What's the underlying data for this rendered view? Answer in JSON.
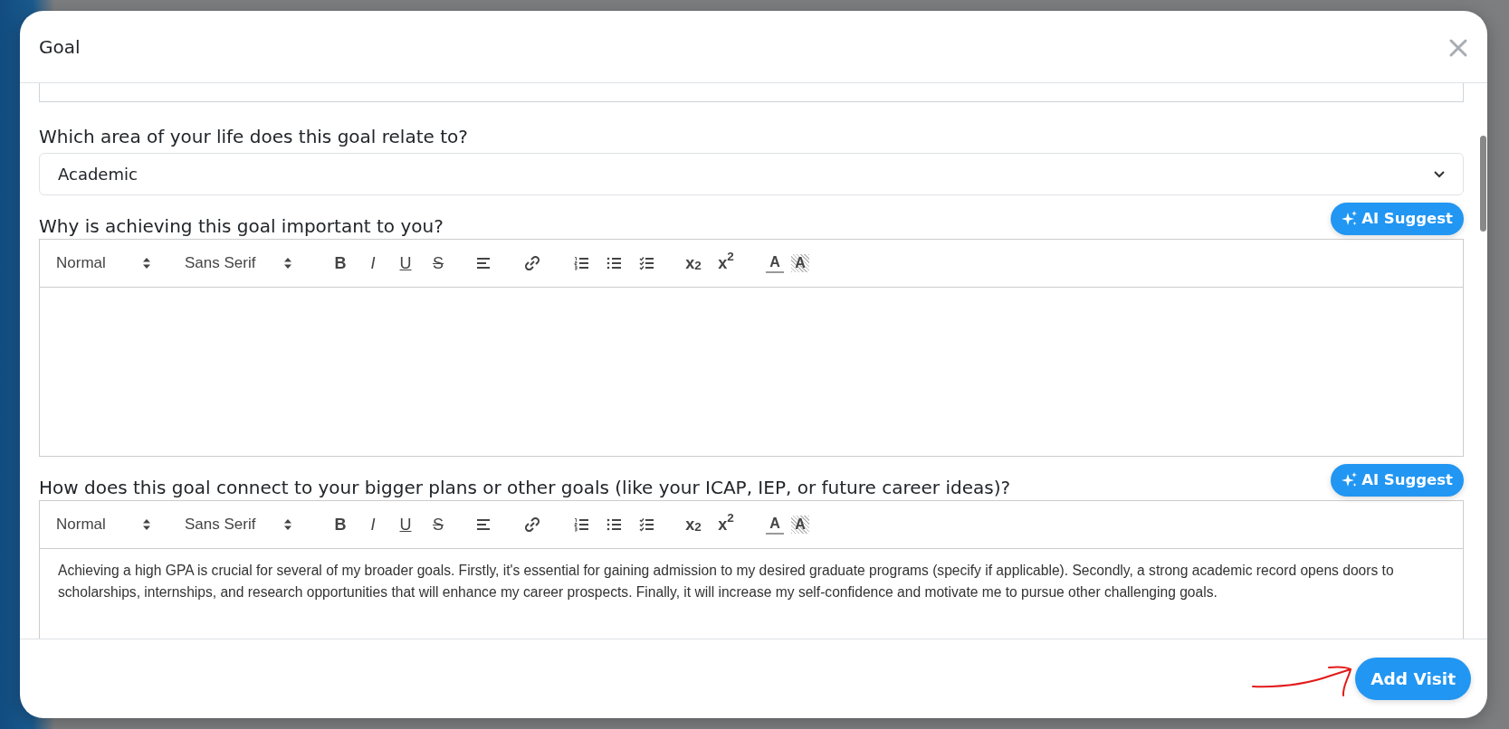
{
  "modal": {
    "title": "Goal"
  },
  "area_question": {
    "label": "Which area of your life does this goal relate to?",
    "value": "Academic"
  },
  "editors": [
    {
      "label": "Why is achieving this goal important to you?",
      "ai_button": "AI Suggest",
      "toolbar": [
        {
          "kind": "select",
          "text": "Normal"
        },
        {
          "kind": "select",
          "text": "Sans Serif"
        },
        {
          "kind": "bold",
          "text": "B"
        },
        {
          "kind": "italic",
          "text": "I"
        },
        {
          "kind": "underline",
          "text": "U"
        },
        {
          "kind": "strike",
          "text": "S"
        },
        {
          "kind": "align"
        },
        {
          "kind": "link"
        },
        {
          "kind": "ordered-list"
        },
        {
          "kind": "bullet-list"
        },
        {
          "kind": "check-list"
        },
        {
          "kind": "script",
          "text": "x$_{2}$"
        },
        {
          "kind": "script",
          "text": "x$^{2}$"
        },
        {
          "kind": "color",
          "text": "A"
        },
        {
          "kind": "background",
          "text": "A"
        }
      ]
    },
    {
      "label": "How does this goal connect to your bigger plans or other goals (like your ICAP, IEP, or future career ideas)?",
      "ai_button": "AI Suggest",
      "toolbar": [
        {
          "kind": "select",
          "text": "Normal"
        },
        {
          "kind": "select",
          "text": "Sans Serif"
        },
        {
          "kind": "bold",
          "text": "B"
        },
        {
          "kind": "italic",
          "text": "I"
        },
        {
          "kind": "underline",
          "text": "U"
        },
        {
          "kind": "strike",
          "text": "S"
        },
        {
          "kind": "align"
        },
        {
          "kind": "link"
        },
        {
          "kind": "ordered-list"
        },
        {
          "kind": "bullet-list"
        },
        {
          "kind": "check-list"
        },
        {
          "kind": "script",
          "text": "x$_{2}$"
        },
        {
          "kind": "script",
          "text": "x$^{2}$"
        },
        {
          "kind": "color",
          "text": "A"
        },
        {
          "kind": "background",
          "text": "A"
        }
      ],
      "content": "Achieving a high GPA is crucial for several of my broader goals. Firstly, it's essential for gaining admission to my desired graduate programs (specify if applicable). Secondly, a strong academic record opens doors to scholarships, internships, and research opportunities that will enhance my career prospects. Finally, it will increase my self-confidence and motivate me to pursue other challenging goals."
    }
  ],
  "footer": {
    "button": "Add Visit"
  }
}
